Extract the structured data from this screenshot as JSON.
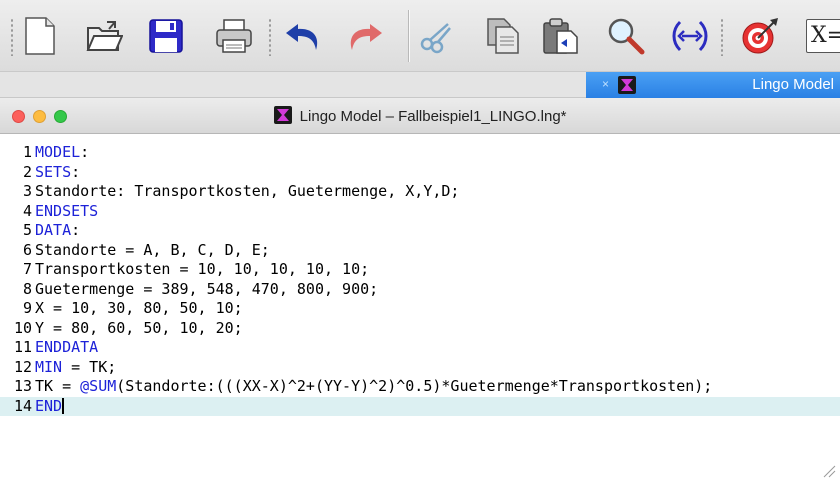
{
  "toolbar": {
    "buttons": [
      {
        "name": "new-file",
        "icon": "new-document-icon"
      },
      {
        "name": "open-file",
        "icon": "open-folder-icon"
      },
      {
        "name": "save",
        "icon": "save-floppy-icon"
      },
      {
        "name": "print",
        "icon": "printer-icon"
      },
      {
        "name": "undo",
        "icon": "undo-arrow-icon"
      },
      {
        "name": "redo",
        "icon": "redo-arrow-icon"
      },
      {
        "name": "cut",
        "icon": "scissors-icon"
      },
      {
        "name": "copy",
        "icon": "copy-icon"
      },
      {
        "name": "paste",
        "icon": "paste-clipboard-icon"
      },
      {
        "name": "find",
        "icon": "magnifier-icon"
      },
      {
        "name": "match-parenthesis",
        "icon": "match-parenthesis-icon"
      },
      {
        "name": "solve",
        "icon": "target-icon"
      },
      {
        "name": "solution",
        "icon": "x-equals-icon"
      }
    ],
    "solution_icon_text": "X="
  },
  "tab": {
    "label": "Lingo Model",
    "close_glyph": "×"
  },
  "window": {
    "title": "Lingo Model – Fallbeispiel1_LINGO.lng*"
  },
  "editor": {
    "lines": [
      {
        "n": "1",
        "tokens": [
          {
            "t": "MODEL",
            "kw": true
          },
          {
            "t": ":"
          }
        ]
      },
      {
        "n": "2",
        "tokens": [
          {
            "t": "SETS",
            "kw": true
          },
          {
            "t": ":"
          }
        ]
      },
      {
        "n": "3",
        "tokens": [
          {
            "t": "Standorte: Transportkosten, Guetermenge, X,Y,D;"
          }
        ]
      },
      {
        "n": "4",
        "tokens": [
          {
            "t": "ENDSETS",
            "kw": true
          }
        ]
      },
      {
        "n": "5",
        "tokens": [
          {
            "t": "DATA",
            "kw": true
          },
          {
            "t": ":"
          }
        ]
      },
      {
        "n": "6",
        "tokens": [
          {
            "t": "Standorte = A, B, C, D, E;"
          }
        ]
      },
      {
        "n": "7",
        "tokens": [
          {
            "t": "Transportkosten = 10, 10, 10, 10, 10;"
          }
        ]
      },
      {
        "n": "8",
        "tokens": [
          {
            "t": "Guetermenge = 389, 548, 470, 800, 900;"
          }
        ]
      },
      {
        "n": "9",
        "tokens": [
          {
            "t": "X = 10, 30, 80, 50, 10;"
          }
        ]
      },
      {
        "n": "10",
        "tokens": [
          {
            "t": "Y = 80, 60, 50, 10, 20;"
          }
        ]
      },
      {
        "n": "11",
        "tokens": [
          {
            "t": "ENDDATA",
            "kw": true
          }
        ]
      },
      {
        "n": "12",
        "tokens": [
          {
            "t": "MIN",
            "kw": true
          },
          {
            "t": " = TK;"
          }
        ]
      },
      {
        "n": "13",
        "tokens": [
          {
            "t": "TK = "
          },
          {
            "t": "@SUM",
            "kw": true
          },
          {
            "t": "(Standorte:(((XX-X)^2+(YY-Y)^2)^0.5)*Guetermenge*Transportkosten);"
          }
        ]
      },
      {
        "n": "14",
        "tokens": [
          {
            "t": "END",
            "kw": true
          }
        ],
        "current": true,
        "caret": true
      }
    ]
  },
  "colors": {
    "keyword": "#1d22d8",
    "current_line": "#dcf0f2",
    "tab_active": "#2a80e4"
  }
}
